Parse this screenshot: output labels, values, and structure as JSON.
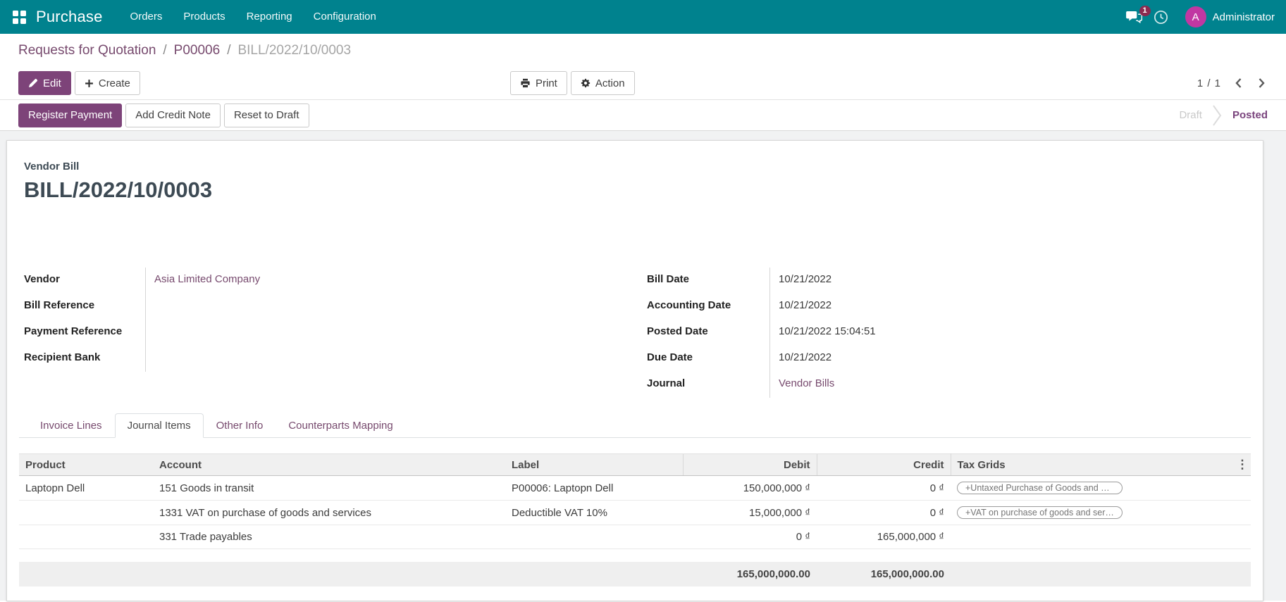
{
  "topbar": {
    "app_name": "Purchase",
    "menus": [
      "Orders",
      "Products",
      "Reporting",
      "Configuration"
    ],
    "messages_badge": "1",
    "avatar_initial": "A",
    "user_name": "Administrator"
  },
  "breadcrumb": {
    "level1": "Requests for Quotation",
    "sep1": "/",
    "level2": "P00006",
    "sep2": "/",
    "current": "BILL/2022/10/0003"
  },
  "control_panel": {
    "edit": "Edit",
    "create": "Create",
    "print": "Print",
    "action": "Action",
    "pager": "1 / 1"
  },
  "statusbar": {
    "register_payment": "Register Payment",
    "add_credit_note": "Add Credit Note",
    "reset_to_draft": "Reset to Draft",
    "state_draft": "Draft",
    "state_posted": "Posted"
  },
  "document": {
    "type_label": "Vendor Bill",
    "name": "BILL/2022/10/0003"
  },
  "fields_left": [
    {
      "label": "Vendor",
      "value": "Asia Limited Company"
    },
    {
      "label": "Bill Reference",
      "value": ""
    },
    {
      "label": "Payment Reference",
      "value": ""
    },
    {
      "label": "Recipient Bank",
      "value": ""
    }
  ],
  "fields_right": [
    {
      "label": "Bill Date",
      "value": "10/21/2022"
    },
    {
      "label": "Accounting Date",
      "value": "10/21/2022"
    },
    {
      "label": "Posted Date",
      "value": "10/21/2022 15:04:51"
    },
    {
      "label": "Due Date",
      "value": "10/21/2022"
    },
    {
      "label": "Journal",
      "value": "Vendor Bills"
    }
  ],
  "tabs": {
    "invoice_lines": "Invoice Lines",
    "journal_items": "Journal Items",
    "other_info": "Other Info",
    "counterparts_mapping": "Counterparts Mapping"
  },
  "journal_table": {
    "headers": {
      "product": "Product",
      "account": "Account",
      "label": "Label",
      "debit": "Debit",
      "credit": "Credit",
      "tax_grids": "Tax Grids",
      "more": "⋮"
    },
    "rows": [
      {
        "product": "Laptopn Dell",
        "account": "151 Goods in transit",
        "label": "P00006: Laptopn Dell",
        "debit": "150,000,000 ₫",
        "credit": "0 ₫",
        "tax_grid": "+Untaxed Purchase of Goods and S…"
      },
      {
        "product": "",
        "account": "1331 VAT on purchase of goods and services",
        "label": "Deductible VAT 10%",
        "debit": "15,000,000 ₫",
        "credit": "0 ₫",
        "tax_grid": "+VAT on purchase of goods and ser…"
      },
      {
        "product": "",
        "account": "331 Trade payables",
        "label": "",
        "debit": "0 ₫",
        "credit": "165,000,000 ₫",
        "tax_grid": ""
      }
    ],
    "totals": {
      "debit": "165,000,000.00",
      "credit": "165,000,000.00"
    }
  },
  "colors": {
    "topbar_teal": "#00828E",
    "primary_purple": "#7d4379",
    "link_purple": "#774a6e",
    "posted_purple": "#7a447d",
    "avatar_magenta": "#c137a2",
    "badge_maroon": "#8c2a50"
  }
}
